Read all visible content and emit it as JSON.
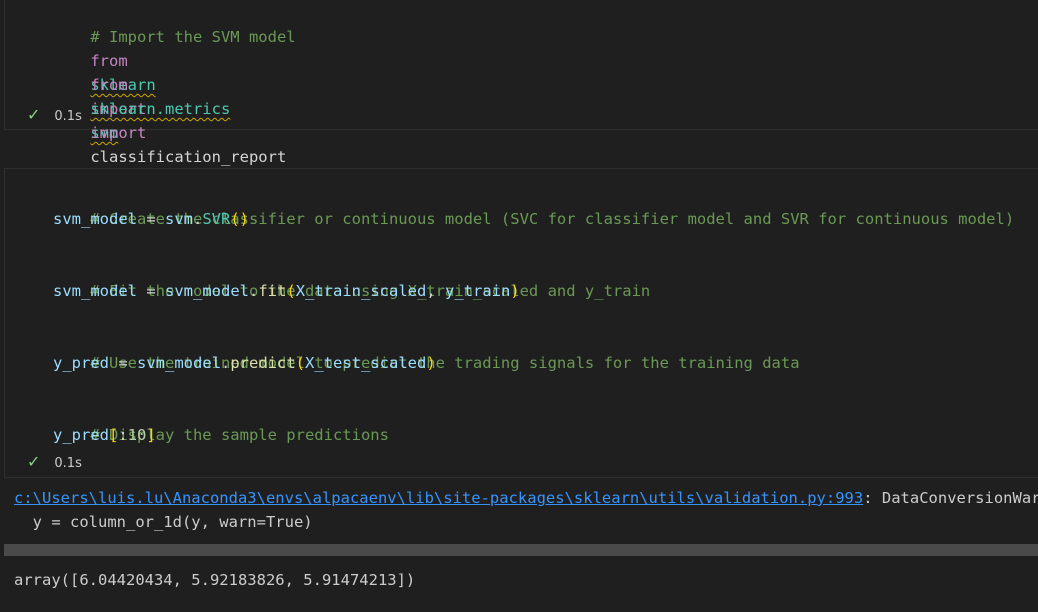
{
  "cell1": {
    "lines": {
      "comment": "# Import the SVM model",
      "l2_from": "from",
      "l2_module": "sklearn",
      "l2_import": "import",
      "l2_name": "svm",
      "l3_from": "from",
      "l3_module": "sklearn.metrics",
      "l3_import": "import",
      "l3_name": "classification_report"
    },
    "status": "0.1s"
  },
  "cell2": {
    "lines": {
      "c1": "# Create the classifier or continuous model (SVC for classifier model and SVR for continuous model)",
      "a1_var": "svm_model",
      "a1_eq": " = ",
      "a1_mod": "svm",
      "a1_dot": ".",
      "a1_cls": "SVR",
      "a1_paren": "()",
      "c2": "# Fit the model to the data using X_train_scaled and y_train",
      "a2_var": "svm_model",
      "a2_eq": " = ",
      "a2_obj": "svm_model",
      "a2_dot": ".",
      "a2_fn": "fit",
      "a2_open": "(",
      "a2_arg1": "X_train_scaled",
      "a2_comma": ", ",
      "a2_arg2": "y_train",
      "a2_close": ")",
      "c3": "# Use the trained model to predict the trading signals for the training data",
      "a3_var": "y_pred",
      "a3_eq": " = ",
      "a3_obj": "svm_model",
      "a3_dot": ".",
      "a3_fn": "predict",
      "a3_open": "(",
      "a3_arg": "X_test_scaled",
      "a3_close": ")",
      "c4": "# Display the sample predictions",
      "a4_var": "y_pred",
      "a4_open": "[",
      "a4_slice": ":",
      "a4_num": "10",
      "a4_close": "]"
    },
    "status": "0.1s"
  },
  "output": {
    "warning_link": "c:\\Users\\luis.lu\\Anaconda3\\envs\\alpacaenv\\lib\\site-packages\\sklearn\\utils\\validation.py:993",
    "warning_text": ": DataConversionWarning",
    "warning_line2": "  y = column_or_1d(y, warn=True)",
    "result": "array([6.04420434, 5.92183826, 5.91474213])"
  },
  "colors": {
    "background": "#1f1f1f",
    "comment": "#6a9955",
    "keyword": "#c586c0",
    "module": "#4ec9b0",
    "variable": "#9cdcfe",
    "function": "#dcdcaa",
    "link": "#3794ff",
    "success": "#89d185"
  },
  "icons": {
    "status": "check-icon"
  }
}
